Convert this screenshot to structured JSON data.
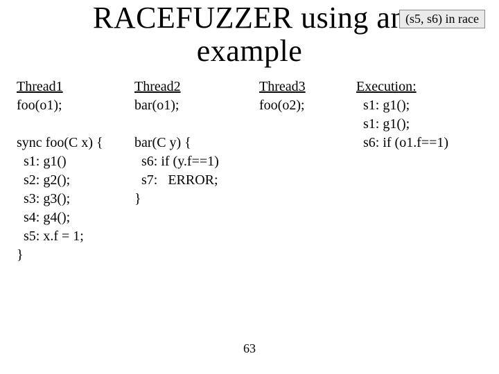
{
  "title_line1": "RACEFUZZER using an",
  "title_line2": "example",
  "badge": "(s5, s6) in race",
  "col1": {
    "head": "Thread1",
    "call": "foo(o1);",
    "sig": "sync foo(C x) {",
    "l1": "  s1: g1()",
    "l2": "  s2: g2();",
    "l3": "  s3: g3();",
    "l4": "  s4: g4();",
    "l5": "  s5: x.f = 1;",
    "end": "}"
  },
  "col2": {
    "head": "Thread2",
    "call": "bar(o1);",
    "sig": "bar(C y) {",
    "l1": "  s6: if (y.f==1)",
    "l2": "  s7:   ERROR;",
    "end": "}"
  },
  "col3": {
    "head": "Thread3",
    "call": "foo(o2);"
  },
  "col4": {
    "head": "Execution:",
    "l1": "  s1: g1();",
    "l2": "  s1: g1();",
    "l3": "  s6: if (o1.f==1)"
  },
  "pagenum": "63"
}
